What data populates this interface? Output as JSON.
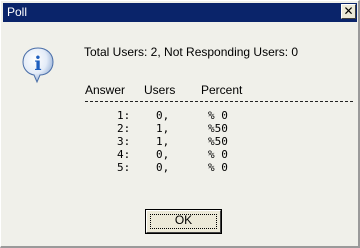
{
  "window": {
    "title": "Poll",
    "close_glyph": "✕"
  },
  "icon": {
    "name": "info-icon",
    "glyph": "i",
    "color": "#1f5fbf"
  },
  "summary": "Total Users: 2, Not Responding Users: 0",
  "table": {
    "headers": [
      "Answer",
      "Users",
      "Percent"
    ],
    "rows": [
      [
        "1:",
        "0,",
        "% 0"
      ],
      [
        "2:",
        "1,",
        "%50"
      ],
      [
        "3:",
        "1,",
        "%50"
      ],
      [
        "4:",
        "0,",
        "% 0"
      ],
      [
        "5:",
        "0,",
        "% 0"
      ]
    ]
  },
  "buttons": {
    "ok_label": "OK"
  }
}
